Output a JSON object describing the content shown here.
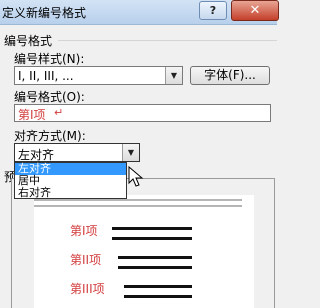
{
  "window": {
    "title": "定义新编号格式",
    "help_label": "?",
    "close_label": "✕"
  },
  "group": {
    "title": "编号格式"
  },
  "number_style": {
    "label": "编号样式(N):",
    "value": "I, II, III, ..."
  },
  "font_button": {
    "label": "字体(F)..."
  },
  "number_format": {
    "label": "编号格式(O):",
    "value": "第I项",
    "mark": "↵"
  },
  "alignment": {
    "label": "对齐方式(M):",
    "value": "左对齐",
    "options": [
      "左对齐",
      "居中",
      "右对齐"
    ],
    "highlighted_index": 0
  },
  "preview": {
    "label": "预",
    "items": [
      "第I项",
      "第II项",
      "第III项"
    ]
  },
  "colors": {
    "accent_red": "#d23c3c",
    "selection_blue": "#3399ff"
  },
  "icons": {
    "dropdown": "chevron-down-icon",
    "cursor": "mouse-pointer-icon",
    "close": "close-icon",
    "help": "help-icon"
  }
}
